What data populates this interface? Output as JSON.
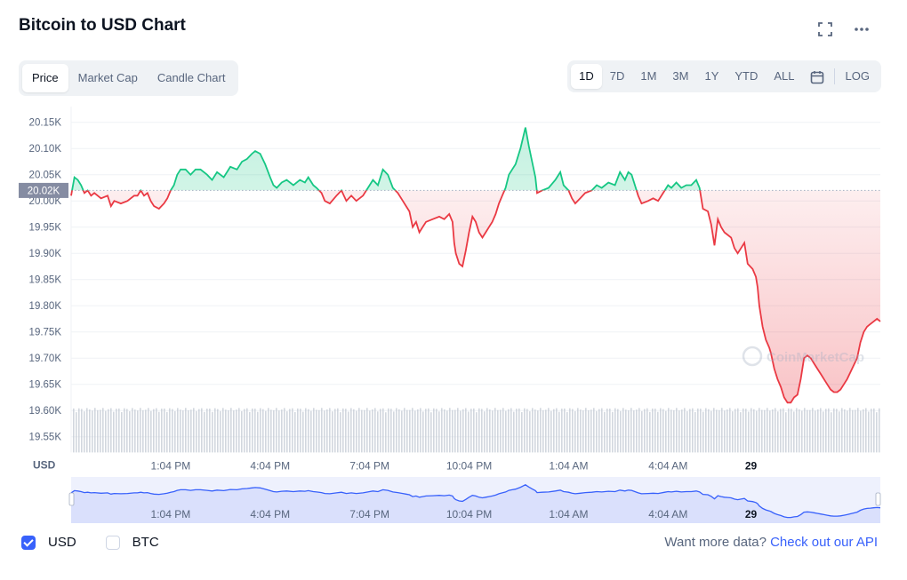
{
  "header": {
    "title": "Bitcoin to USD Chart"
  },
  "tabs": [
    "Price",
    "Market Cap",
    "Candle Chart"
  ],
  "active_tab": "Price",
  "ranges": [
    "1D",
    "7D",
    "1M",
    "3M",
    "1Y",
    "YTD",
    "ALL"
  ],
  "active_range": "1D",
  "log_label": "LOG",
  "legend": {
    "usd_label": "USD",
    "btc_label": "BTC"
  },
  "footer": {
    "prompt": "Want more data?",
    "link": "Check out our API"
  },
  "chart_data": {
    "type": "area",
    "ylabel": "USD",
    "ylim": [
      19520,
      20180
    ],
    "y_ticks": [
      "20.15K",
      "20.10K",
      "20.05K",
      "20.00K",
      "19.95K",
      "19.90K",
      "19.85K",
      "19.80K",
      "19.75K",
      "19.70K",
      "19.65K",
      "19.60K",
      "19.55K"
    ],
    "y_tick_values": [
      20150,
      20100,
      20050,
      20000,
      19950,
      19900,
      19850,
      19800,
      19750,
      19700,
      19650,
      19600,
      19550
    ],
    "x_ticks": [
      "1:04 PM",
      "4:04 PM",
      "7:04 PM",
      "10:04 PM",
      "1:04 AM",
      "4:04 AM",
      "29"
    ],
    "x_tick_hours": [
      3,
      6,
      9,
      12,
      15,
      18,
      20.5
    ],
    "x_range_hours": [
      0,
      24.4
    ],
    "reference_price": 20020,
    "reference_label": "20.02K",
    "colors": {
      "up": "#16c784",
      "down": "#ea3943",
      "volume": "#c3c9d3",
      "nav": "#3861fb",
      "ref_badge": "#858ca2"
    },
    "watermark": "CoinMarketCap",
    "series": [
      {
        "values": [
          [
            0,
            20010
          ],
          [
            0.1,
            20045
          ],
          [
            0.2,
            20040
          ],
          [
            0.3,
            20030
          ],
          [
            0.4,
            20015
          ],
          [
            0.5,
            20020
          ],
          [
            0.6,
            20010
          ],
          [
            0.7,
            20015
          ],
          [
            0.9,
            20005
          ],
          [
            1.1,
            20010
          ],
          [
            1.2,
            19990
          ],
          [
            1.3,
            20000
          ],
          [
            1.5,
            19995
          ],
          [
            1.7,
            20000
          ],
          [
            1.9,
            20010
          ],
          [
            2.0,
            20010
          ],
          [
            2.1,
            20020
          ],
          [
            2.2,
            20010
          ],
          [
            2.3,
            20015
          ],
          [
            2.4,
            20000
          ],
          [
            2.5,
            19990
          ],
          [
            2.65,
            19985
          ],
          [
            2.8,
            19995
          ],
          [
            2.9,
            20005
          ],
          [
            3.0,
            20020
          ],
          [
            3.1,
            20030
          ],
          [
            3.2,
            20050
          ],
          [
            3.3,
            20060
          ],
          [
            3.45,
            20060
          ],
          [
            3.6,
            20050
          ],
          [
            3.75,
            20060
          ],
          [
            3.9,
            20060
          ],
          [
            4.1,
            20050
          ],
          [
            4.25,
            20040
          ],
          [
            4.4,
            20055
          ],
          [
            4.6,
            20045
          ],
          [
            4.8,
            20065
          ],
          [
            5.0,
            20060
          ],
          [
            5.15,
            20075
          ],
          [
            5.3,
            20080
          ],
          [
            5.45,
            20090
          ],
          [
            5.55,
            20095
          ],
          [
            5.7,
            20090
          ],
          [
            5.85,
            20070
          ],
          [
            6.0,
            20045
          ],
          [
            6.1,
            20030
          ],
          [
            6.2,
            20025
          ],
          [
            6.35,
            20035
          ],
          [
            6.5,
            20040
          ],
          [
            6.7,
            20030
          ],
          [
            6.9,
            20040
          ],
          [
            7.05,
            20035
          ],
          [
            7.15,
            20045
          ],
          [
            7.3,
            20030
          ],
          [
            7.4,
            20025
          ],
          [
            7.55,
            20015
          ],
          [
            7.65,
            20000
          ],
          [
            7.8,
            19995
          ],
          [
            8.0,
            20010
          ],
          [
            8.15,
            20020
          ],
          [
            8.3,
            20000
          ],
          [
            8.45,
            20010
          ],
          [
            8.6,
            20000
          ],
          [
            8.8,
            20010
          ],
          [
            9.0,
            20030
          ],
          [
            9.1,
            20040
          ],
          [
            9.25,
            20030
          ],
          [
            9.4,
            20060
          ],
          [
            9.55,
            20050
          ],
          [
            9.7,
            20025
          ],
          [
            9.85,
            20015
          ],
          [
            10.0,
            20000
          ],
          [
            10.1,
            19990
          ],
          [
            10.2,
            19980
          ],
          [
            10.3,
            19950
          ],
          [
            10.4,
            19960
          ],
          [
            10.5,
            19940
          ],
          [
            10.6,
            19950
          ],
          [
            10.7,
            19960
          ],
          [
            10.9,
            19965
          ],
          [
            11.1,
            19970
          ],
          [
            11.25,
            19965
          ],
          [
            11.4,
            19975
          ],
          [
            11.5,
            19960
          ],
          [
            11.55,
            19920
          ],
          [
            11.6,
            19900
          ],
          [
            11.7,
            19880
          ],
          [
            11.8,
            19875
          ],
          [
            11.9,
            19905
          ],
          [
            12.0,
            19940
          ],
          [
            12.1,
            19970
          ],
          [
            12.2,
            19960
          ],
          [
            12.3,
            19940
          ],
          [
            12.4,
            19930
          ],
          [
            12.5,
            19940
          ],
          [
            12.6,
            19950
          ],
          [
            12.7,
            19960
          ],
          [
            12.8,
            19975
          ],
          [
            12.9,
            19995
          ],
          [
            13.0,
            20010
          ],
          [
            13.1,
            20025
          ],
          [
            13.2,
            20050
          ],
          [
            13.3,
            20060
          ],
          [
            13.4,
            20070
          ],
          [
            13.55,
            20100
          ],
          [
            13.7,
            20140
          ],
          [
            13.8,
            20105
          ],
          [
            13.9,
            20075
          ],
          [
            14.0,
            20045
          ],
          [
            14.05,
            20015
          ],
          [
            14.2,
            20020
          ],
          [
            14.4,
            20025
          ],
          [
            14.6,
            20040
          ],
          [
            14.75,
            20055
          ],
          [
            14.85,
            20030
          ],
          [
            15.0,
            20020
          ],
          [
            15.1,
            20005
          ],
          [
            15.2,
            19995
          ],
          [
            15.35,
            20005
          ],
          [
            15.5,
            20015
          ],
          [
            15.7,
            20020
          ],
          [
            15.85,
            20030
          ],
          [
            16.0,
            20025
          ],
          [
            16.2,
            20035
          ],
          [
            16.4,
            20030
          ],
          [
            16.55,
            20055
          ],
          [
            16.7,
            20040
          ],
          [
            16.8,
            20055
          ],
          [
            16.9,
            20050
          ],
          [
            17.0,
            20030
          ],
          [
            17.1,
            20010
          ],
          [
            17.2,
            19995
          ],
          [
            17.4,
            20000
          ],
          [
            17.55,
            20005
          ],
          [
            17.7,
            20000
          ],
          [
            17.9,
            20020
          ],
          [
            18.0,
            20030
          ],
          [
            18.1,
            20025
          ],
          [
            18.25,
            20035
          ],
          [
            18.4,
            20025
          ],
          [
            18.55,
            20030
          ],
          [
            18.7,
            20030
          ],
          [
            18.85,
            20040
          ],
          [
            18.95,
            20025
          ],
          [
            19.05,
            19985
          ],
          [
            19.2,
            19980
          ],
          [
            19.3,
            19955
          ],
          [
            19.4,
            19915
          ],
          [
            19.5,
            19965
          ],
          [
            19.6,
            19950
          ],
          [
            19.7,
            19940
          ],
          [
            19.8,
            19935
          ],
          [
            19.9,
            19930
          ],
          [
            20.0,
            19910
          ],
          [
            20.1,
            19900
          ],
          [
            20.2,
            19910
          ],
          [
            20.3,
            19920
          ],
          [
            20.4,
            19880
          ],
          [
            20.55,
            19870
          ],
          [
            20.65,
            19855
          ],
          [
            20.7,
            19835
          ],
          [
            20.75,
            19800
          ],
          [
            20.85,
            19760
          ],
          [
            20.95,
            19735
          ],
          [
            21.05,
            19720
          ],
          [
            21.1,
            19710
          ],
          [
            21.2,
            19680
          ],
          [
            21.3,
            19660
          ],
          [
            21.4,
            19645
          ],
          [
            21.5,
            19625
          ],
          [
            21.6,
            19615
          ],
          [
            21.7,
            19615
          ],
          [
            21.8,
            19625
          ],
          [
            21.9,
            19630
          ],
          [
            22.0,
            19660
          ],
          [
            22.1,
            19700
          ],
          [
            22.2,
            19705
          ],
          [
            22.3,
            19700
          ],
          [
            22.4,
            19690
          ],
          [
            22.5,
            19680
          ],
          [
            22.6,
            19670
          ],
          [
            22.7,
            19660
          ],
          [
            22.8,
            19650
          ],
          [
            22.9,
            19640
          ],
          [
            23.0,
            19635
          ],
          [
            23.1,
            19635
          ],
          [
            23.2,
            19640
          ],
          [
            23.3,
            19650
          ],
          [
            23.4,
            19660
          ],
          [
            23.55,
            19680
          ],
          [
            23.7,
            19700
          ],
          [
            23.8,
            19730
          ],
          [
            23.9,
            19750
          ],
          [
            24.0,
            19760
          ],
          [
            24.1,
            19765
          ],
          [
            24.2,
            19770
          ],
          [
            24.3,
            19775
          ],
          [
            24.4,
            19770
          ]
        ]
      }
    ]
  }
}
